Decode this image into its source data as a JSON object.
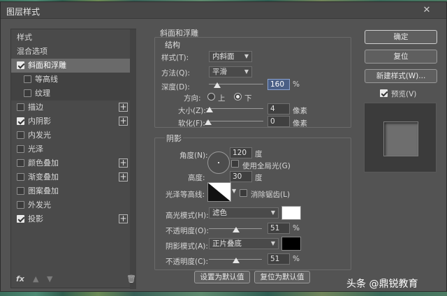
{
  "window": {
    "title": "图层样式"
  },
  "left_panel": {
    "header": "样式",
    "items": [
      {
        "label": "混合选项",
        "checkbox": false,
        "checked": false,
        "plus": false,
        "selected": false,
        "sub": false
      },
      {
        "label": "斜面和浮雕",
        "checkbox": true,
        "checked": true,
        "plus": false,
        "selected": true,
        "sub": false
      },
      {
        "label": "等高线",
        "checkbox": true,
        "checked": false,
        "plus": false,
        "selected": false,
        "sub": true
      },
      {
        "label": "纹理",
        "checkbox": true,
        "checked": false,
        "plus": false,
        "selected": false,
        "sub": true
      },
      {
        "label": "描边",
        "checkbox": true,
        "checked": false,
        "plus": true,
        "selected": false,
        "sub": false
      },
      {
        "label": "内阴影",
        "checkbox": true,
        "checked": true,
        "plus": true,
        "selected": false,
        "sub": false
      },
      {
        "label": "内发光",
        "checkbox": true,
        "checked": false,
        "plus": false,
        "selected": false,
        "sub": false
      },
      {
        "label": "光泽",
        "checkbox": true,
        "checked": false,
        "plus": false,
        "selected": false,
        "sub": false
      },
      {
        "label": "颜色叠加",
        "checkbox": true,
        "checked": false,
        "plus": true,
        "selected": false,
        "sub": false
      },
      {
        "label": "渐变叠加",
        "checkbox": true,
        "checked": false,
        "plus": true,
        "selected": false,
        "sub": false
      },
      {
        "label": "图案叠加",
        "checkbox": true,
        "checked": false,
        "plus": false,
        "selected": false,
        "sub": false
      },
      {
        "label": "外发光",
        "checkbox": true,
        "checked": false,
        "plus": false,
        "selected": false,
        "sub": false
      },
      {
        "label": "投影",
        "checkbox": true,
        "checked": true,
        "plus": true,
        "selected": false,
        "sub": false
      }
    ],
    "footer": {
      "fx": "fx",
      "plus_glyph": "+"
    }
  },
  "bevel": {
    "section_title": "斜面和浮雕",
    "structure_title": "结构",
    "style_label": "样式(T):",
    "style_value": "内斜面",
    "method_label": "方法(Q):",
    "method_value": "平滑",
    "depth_label": "深度(D):",
    "depth_value": "160",
    "depth_level": 0.16,
    "depth_unit": "%",
    "direction_label": "方向:",
    "dir_up": "上",
    "dir_down": "下",
    "direction_selected": "下",
    "size_label": "大小(Z):",
    "size_value": "4",
    "size_unit": "像素",
    "soften_label": "软化(F):",
    "soften_value": "0",
    "soften_unit": "像素"
  },
  "shading": {
    "title": "阴影",
    "angle_label": "角度(N):",
    "angle_value": "120",
    "angle_unit": "度",
    "global_light_label": "使用全局光(G)",
    "global_light_checked": false,
    "altitude_label": "高度:",
    "altitude_value": "30",
    "altitude_unit": "度",
    "gloss_contour_label": "光泽等高线:",
    "antialias_label": "消除锯齿(L)",
    "antialias_checked": false,
    "highlight_mode_label": "高光模式(H):",
    "highlight_mode_value": "滤色",
    "highlight_color": "#ffffff",
    "highlight_opacity_label": "不透明度(O):",
    "highlight_opacity_value": "51",
    "highlight_opacity_unit": "%",
    "shadow_mode_label": "阴影模式(A):",
    "shadow_mode_value": "正片叠底",
    "shadow_color": "#000000",
    "shadow_opacity_label": "不透明度(C):",
    "shadow_opacity_value": "51",
    "shadow_opacity_unit": "%"
  },
  "buttons": {
    "set_default": "设置为默认值",
    "reset_default": "复位为默认值",
    "ok": "确定",
    "reset": "复位",
    "new_style": "新建样式(W)...",
    "preview_label": "预览(V)",
    "preview_checked": true
  },
  "watermark": "头条 @鼎锐教育"
}
